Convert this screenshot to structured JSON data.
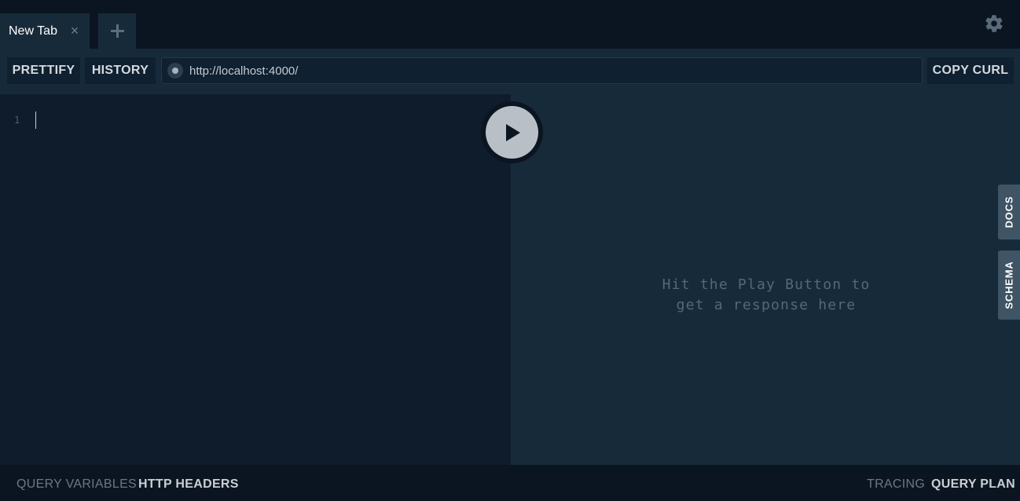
{
  "tabs": [
    {
      "label": "New Tab",
      "active": true
    }
  ],
  "tabbar": {
    "close_symbol": "×",
    "new_tab_icon": "plus-icon",
    "settings_icon": "gear-icon"
  },
  "toolbar": {
    "prettify_label": "PRETTIFY",
    "history_label": "HISTORY",
    "url": "http://localhost:4000/",
    "copy_curl_label": "COPY CURL"
  },
  "editor": {
    "line_numbers": [
      "1"
    ]
  },
  "result": {
    "placeholder": "Hit the Play Button to\nget a response here"
  },
  "side_tabs": {
    "docs": "DOCS",
    "schema": "SCHEMA"
  },
  "footer": {
    "query_variables": "QUERY VARIABLES",
    "http_headers": "HTTP HEADERS",
    "tracing": "TRACING",
    "query_plan": "QUERY PLAN"
  },
  "colors": {
    "background": "#0b1521",
    "panel": "#172a3a",
    "editor": "#0f1c2c",
    "side_tab": "#3f5465",
    "play_button": "#b9bfc6"
  }
}
